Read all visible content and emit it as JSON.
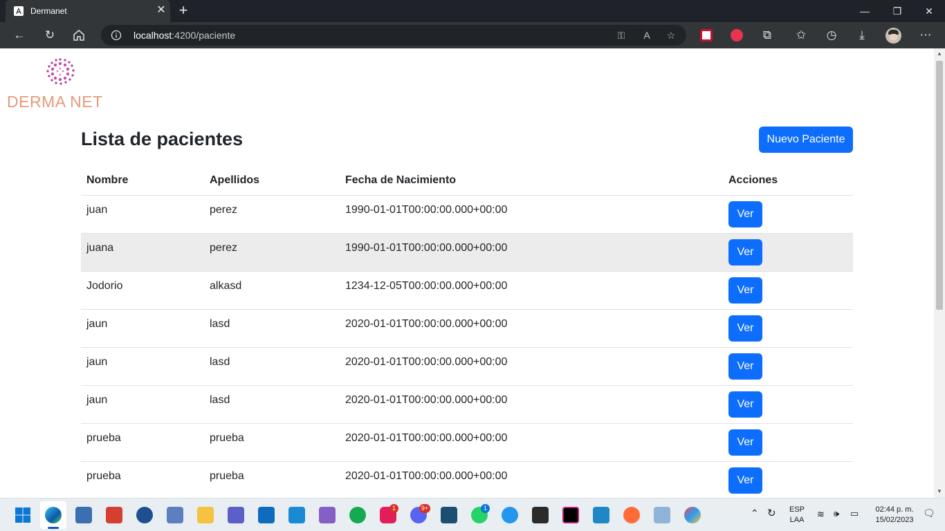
{
  "browser": {
    "tab_title": "Dermanet",
    "tab_close": "✕",
    "new_tab": "+",
    "window_controls": [
      "—",
      "❐",
      "✕"
    ],
    "url_host": "localhost",
    "url_rest": ":4200/paciente"
  },
  "page": {
    "logo_text": "DERMA NET",
    "title": "Lista de pacientes",
    "new_button": "Nuevo Paciente",
    "columns": [
      "Nombre",
      "Apellidos",
      "Fecha de Nacimiento",
      "Acciones"
    ],
    "action_label": "Ver",
    "rows": [
      {
        "nombre": "juan",
        "apellidos": "perez",
        "fecha": "1990-01-01T00:00:00.000+00:00"
      },
      {
        "nombre": "juana",
        "apellidos": "perez",
        "fecha": "1990-01-01T00:00:00.000+00:00"
      },
      {
        "nombre": "Jodorio",
        "apellidos": "alkasd",
        "fecha": "1234-12-05T00:00:00.000+00:00"
      },
      {
        "nombre": "jaun",
        "apellidos": "lasd",
        "fecha": "2020-01-01T00:00:00.000+00:00"
      },
      {
        "nombre": "jaun",
        "apellidos": "lasd",
        "fecha": "2020-01-01T00:00:00.000+00:00"
      },
      {
        "nombre": "jaun",
        "apellidos": "lasd",
        "fecha": "2020-01-01T00:00:00.000+00:00"
      },
      {
        "nombre": "prueba",
        "apellidos": "prueba",
        "fecha": "2020-01-01T00:00:00.000+00:00"
      },
      {
        "nombre": "prueba",
        "apellidos": "prueba",
        "fecha": "2020-01-01T00:00:00.000+00:00"
      }
    ]
  },
  "taskbar": {
    "lang_top": "ESP",
    "lang_bottom": "LAA",
    "time": "02:44 p. m.",
    "date": "15/02/2023",
    "badges": [
      "1",
      "9+",
      "1"
    ]
  },
  "colors": {
    "primary": "#0d6efd",
    "logo": "#e69a7c",
    "logo_dots": "#b03a9e"
  }
}
